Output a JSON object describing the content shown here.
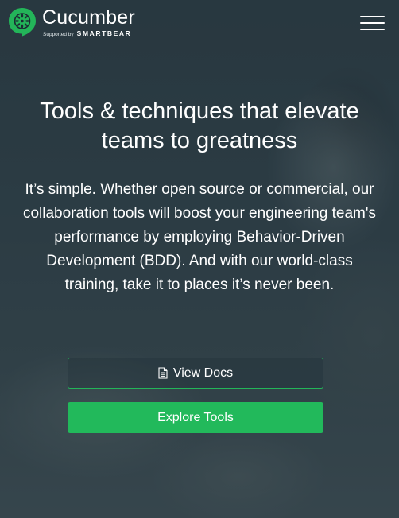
{
  "brand": {
    "name": "Cucumber",
    "supported_by": "Supported by",
    "partner": "SMARTBEAR",
    "accent_color": "#23b559"
  },
  "header": {
    "menu_icon": "hamburger-menu-icon"
  },
  "hero": {
    "title": "Tools & techniques that elevate teams to greatness",
    "body": "It’s simple. Whether open source or commercial, our collaboration tools will boost your engineering team's performance by employing Behavior-Driven Development (BDD). And with our world-class training, take it to places it’s never been.",
    "buttons": {
      "docs_label": "View Docs",
      "docs_icon": "document-icon",
      "tools_label": "Explore Tools"
    }
  }
}
